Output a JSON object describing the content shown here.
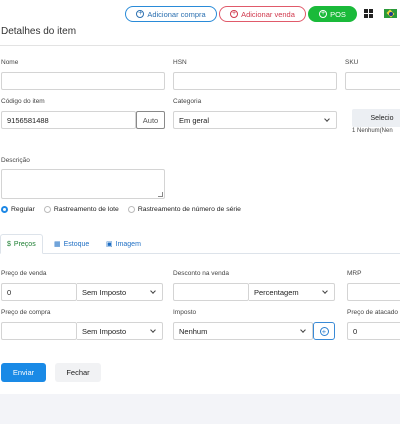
{
  "header": {
    "buttons": [
      {
        "label": "Adicionar compra",
        "icon": "plus-circle-icon",
        "color": "#2a8bd8"
      },
      {
        "label": "Adicionar venda",
        "icon": "plus-circle-icon",
        "color": "#e05a6a"
      },
      {
        "label": "POS",
        "icon": "plus-circle-icon",
        "color": "#1aba3a"
      }
    ],
    "apps_icon": "grid-icon",
    "language_icon": "brazil-flag-icon"
  },
  "form": {
    "title": "Detalhes do item",
    "fields": {
      "nome": {
        "label": "Nome",
        "value": ""
      },
      "hsn": {
        "label": "HSN",
        "value": ""
      },
      "sku": {
        "label": "SKU",
        "value": ""
      },
      "codigo": {
        "label": "Código do item",
        "value": "9156581488",
        "button": "Auto"
      },
      "categoria": {
        "label": "Categoria",
        "value": "Em geral"
      },
      "selecionar": {
        "button": "Selecio",
        "note": "1 Nenhum(Nen"
      },
      "descricao": {
        "label": "Descrição",
        "value": ""
      }
    },
    "tracking": {
      "options": [
        "Regular",
        "Rastreamento de lote",
        "Rastreamento de número de série"
      ],
      "selected": "Regular"
    },
    "tabs": [
      {
        "label": "Preços",
        "icon": "dollar-icon"
      },
      {
        "label": "Estoque",
        "icon": "calendar-icon"
      },
      {
        "label": "Imagem",
        "icon": "image-icon"
      }
    ],
    "active_tab": "Preços",
    "pricing": {
      "preco_venda": {
        "label": "Preço de venda",
        "value": "0",
        "tax": "Sem Imposto"
      },
      "desconto": {
        "label": "Desconto na venda",
        "value": "",
        "type": "Percentagem"
      },
      "mrp": {
        "label": "MRP",
        "value": ""
      },
      "preco_compra": {
        "label": "Preço de compra",
        "value": "",
        "tax": "Sem Imposto"
      },
      "imposto": {
        "label": "Imposto",
        "value": "Nenhum"
      },
      "preco_atacado": {
        "label": "Preço de atacado",
        "value": "0"
      }
    },
    "actions": {
      "submit": "Enviar",
      "close": "Fechar"
    }
  }
}
